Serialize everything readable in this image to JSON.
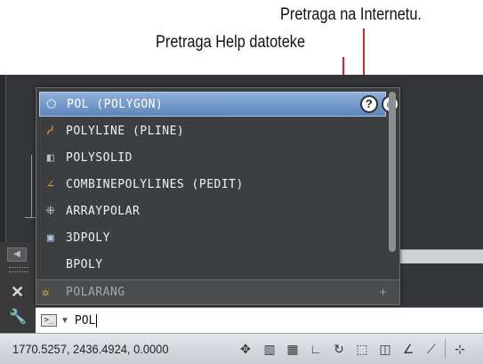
{
  "annotations": {
    "internet_search": "Pretraga na Internetu.",
    "help_search": "Pretraga Help datoteke"
  },
  "autocomplete": {
    "items": [
      {
        "label": "POL (POLYGON)",
        "icon": "polygon-icon",
        "selected": true
      },
      {
        "label": "POLYLINE (PLINE)",
        "icon": "polyline-icon"
      },
      {
        "label": "POLYSOLID",
        "icon": "polysolid-icon"
      },
      {
        "label": "COMBINEPOLYLINES (PEDIT)",
        "icon": "pedit-icon"
      },
      {
        "label": "ARRAYPOLAR",
        "icon": "arraypolar-icon"
      },
      {
        "label": "3DPOLY",
        "icon": "3dpoly-icon"
      },
      {
        "label": "BPOLY",
        "icon": ""
      }
    ],
    "bottom_item": {
      "label": "POLARANG",
      "icon": "sysvar-icon"
    },
    "help_button": "?",
    "colors": {
      "selected_top": "#8fb0d8",
      "selected_bottom": "#5d86bd",
      "background": "#3d3e40"
    }
  },
  "command_line": {
    "prompt_icon": ">_",
    "value": "POL"
  },
  "status_bar": {
    "coordinates": "1770.5257, 2436.4924, 0.0000"
  }
}
